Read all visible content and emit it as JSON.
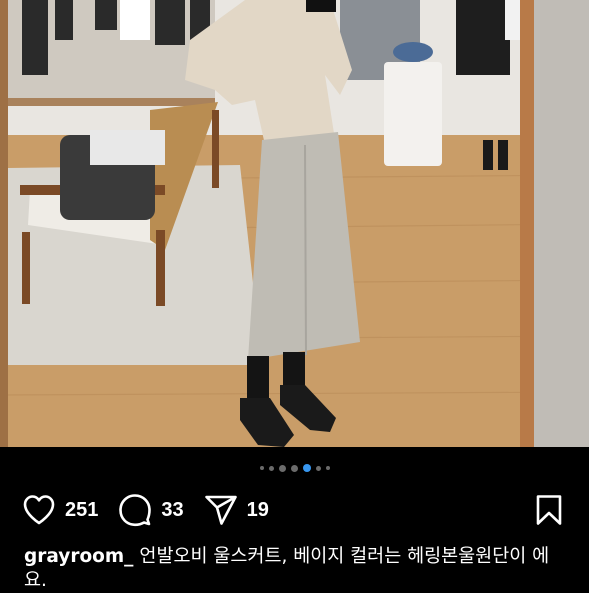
{
  "carousel": {
    "dots": 7,
    "active_index": 4
  },
  "actions": {
    "like_icon": "heart-icon",
    "like_count": "251",
    "comment_icon": "comment-bubble-icon",
    "comment_count": "33",
    "share_icon": "paper-plane-icon",
    "share_count": "19",
    "save_icon": "bookmark-icon"
  },
  "post": {
    "username": "grayroom_",
    "caption": "언발오비 울스커트, 베이지 컬러는 헤링본울원단이 에요."
  },
  "colors": {
    "background": "#000000",
    "text": "#ffffff",
    "active_dot": "#3897f0"
  }
}
